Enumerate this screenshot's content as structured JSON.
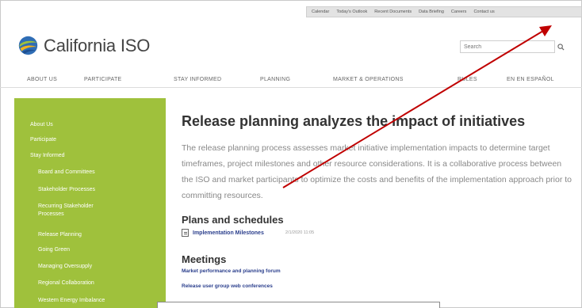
{
  "utility_bar": {
    "links": [
      "Calendar",
      "Today's Outlook",
      "Recent Documents",
      "Data Briefing",
      "Careers",
      "Contact us"
    ]
  },
  "logo": {
    "text": "California ISO",
    "icon": "caiso-globe-logo"
  },
  "search": {
    "placeholder": "Search",
    "icon": "search-icon"
  },
  "nav": {
    "items": [
      "ABOUT US",
      "PARTICIPATE",
      "STAY INFORMED",
      "PLANNING",
      "MARKET & OPERATIONS",
      "RULES",
      "EN EN ESPAÑOL"
    ]
  },
  "sidebar": {
    "items": [
      {
        "label": "About Us",
        "level": "top"
      },
      {
        "label": "Participate",
        "level": "top"
      },
      {
        "label": "Stay Informed",
        "level": "top"
      },
      {
        "label": "Board and Committees",
        "level": "sub"
      },
      {
        "label": "Stakeholder Processes",
        "level": "sub"
      },
      {
        "label": "Recurring Stakeholder",
        "level": "sub"
      },
      {
        "label": "Processes",
        "level": "sub"
      },
      {
        "label": "Release Planning",
        "level": "sub"
      },
      {
        "label": "Going Green",
        "level": "sub"
      },
      {
        "label": "Managing Oversupply",
        "level": "sub"
      },
      {
        "label": "Regional Collaboration",
        "level": "sub"
      },
      {
        "label": "Western Energy Imbalance",
        "level": "sub"
      }
    ]
  },
  "content": {
    "title": "Release planning analyzes the impact of initiatives",
    "intro": "The release planning process assesses market initiative implementation impacts to determine target timeframes, project milestones and other resource considerations. It is a collaborative process between the ISO and market participants to optimize the costs and benefits of the implementation approach prior to committing resources.",
    "plans_heading": "Plans and schedules",
    "plans_doc": {
      "label": "Implementation Milestones",
      "date": "2/1/2020 11:05"
    },
    "meetings_heading": "Meetings",
    "meetings_links": [
      "Market performance and planning forum",
      "Release user group web conferences"
    ]
  },
  "colors": {
    "sidebar_green": "#9fc13c",
    "link_blue": "#2a3e8c",
    "annotation_arrow": "#c00000"
  }
}
